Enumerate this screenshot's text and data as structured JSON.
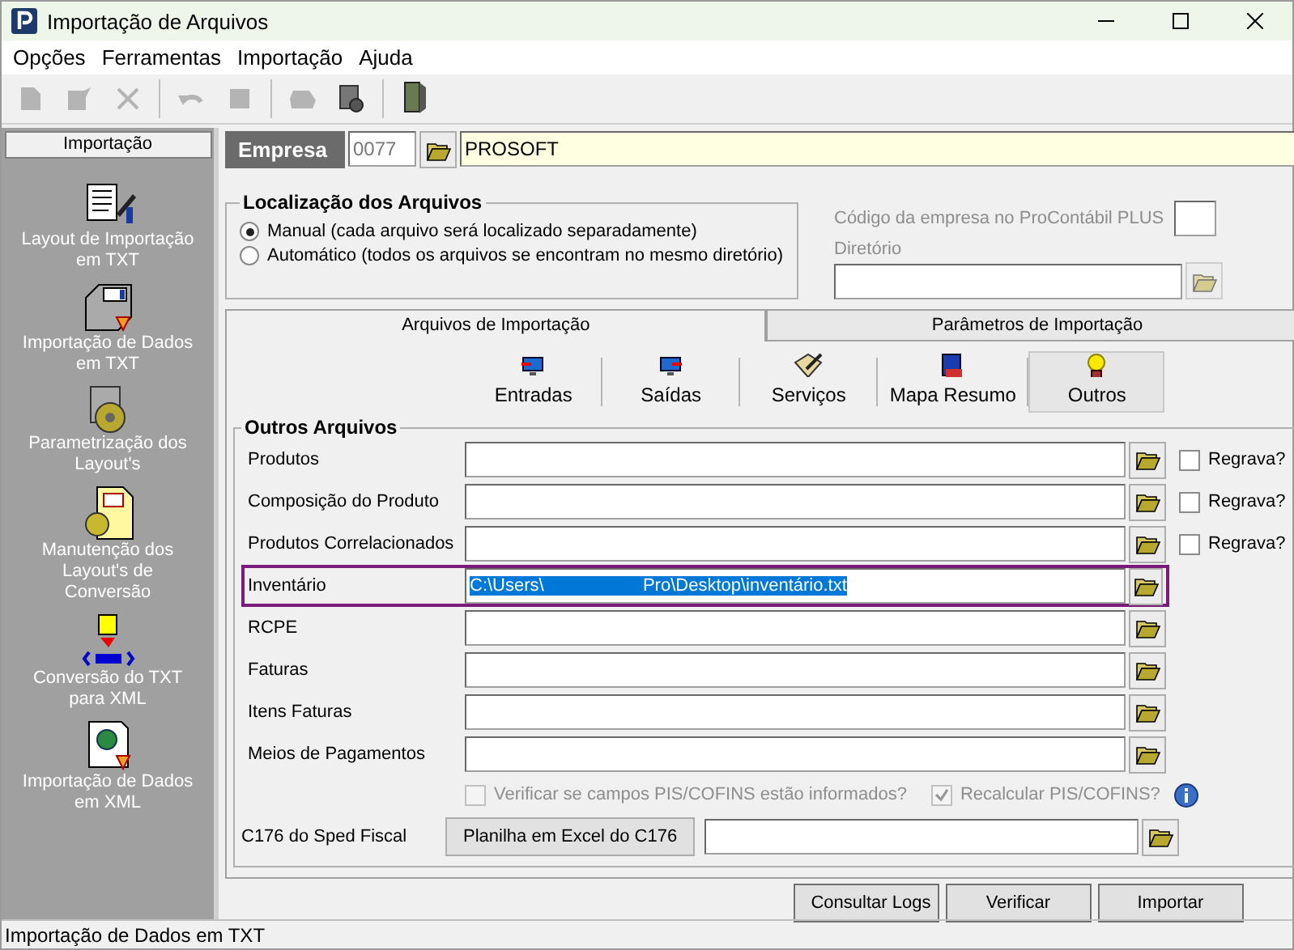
{
  "window": {
    "title": "Importação de Arquivos"
  },
  "menu": [
    "Opções",
    "Ferramentas",
    "Importação",
    "Ajuda"
  ],
  "toolbar": [
    {
      "kind": "new",
      "disabled": true
    },
    {
      "kind": "edit",
      "disabled": true
    },
    {
      "kind": "delete",
      "disabled": true
    },
    {
      "kind": "undo",
      "disabled": true
    },
    {
      "kind": "save",
      "disabled": true
    },
    {
      "kind": "print",
      "disabled": true
    },
    {
      "kind": "tools",
      "disabled": false
    },
    {
      "kind": "exit",
      "disabled": false
    }
  ],
  "sidebar": {
    "header": "Importação",
    "items": [
      {
        "label": "Layout de Importação em TXT",
        "kind": "layout"
      },
      {
        "label": "Importação de Dados em TXT",
        "kind": "import"
      },
      {
        "label": "Parametrização dos Layout's",
        "kind": "param"
      },
      {
        "label": "Manutenção dos Layout's de Conversão",
        "kind": "maint"
      },
      {
        "label": "Conversão do TXT para XML",
        "kind": "xml"
      },
      {
        "label": "Importação de Dados em XML",
        "kind": "webdoc"
      }
    ]
  },
  "empresa": {
    "label": "Empresa",
    "code": "0077",
    "name": "PROSOFT"
  },
  "location": {
    "title": "Localização dos Arquivos",
    "options": [
      {
        "label": "Manual (cada arquivo será localizado separadamente)",
        "selected": true
      },
      {
        "label": "Automático (todos os arquivos se encontram no mesmo diretório)",
        "selected": false
      }
    ]
  },
  "procontabil": {
    "label": "Código da empresa no ProContábil PLUS",
    "directory_label": "Diretório",
    "disabled": true
  },
  "tabs": [
    {
      "label": "Arquivos de Importação",
      "selected": true
    },
    {
      "label": "Parâmetros de Importação",
      "selected": false
    }
  ],
  "subtabs": [
    {
      "label": "Entradas",
      "kind": "monitor-in",
      "selected": false
    },
    {
      "label": "Saídas",
      "kind": "monitor-out",
      "selected": false
    },
    {
      "label": "Serviços",
      "kind": "pen",
      "selected": false
    },
    {
      "label": "Mapa Resumo",
      "kind": "book",
      "selected": false
    },
    {
      "label": "Outros",
      "kind": "bulb",
      "selected": true
    }
  ],
  "files": {
    "title": "Outros Arquivos",
    "rows": [
      {
        "label": "Produtos",
        "value": "",
        "highlighted": false,
        "regrava": {
          "label": "Regrava?",
          "checked": false
        }
      },
      {
        "label": "Composição do Produto",
        "value": "",
        "highlighted": false,
        "regrava": {
          "label": "Regrava?",
          "checked": false
        }
      },
      {
        "label": "Produtos Correlacionados",
        "value": "",
        "highlighted": false,
        "regrava": {
          "label": "Regrava?",
          "checked": false
        }
      },
      {
        "label": "Inventário",
        "value": "C:\\Users\\                    Pro\\Desktop\\inventário.txt",
        "highlighted": true
      },
      {
        "label": "RCPE",
        "value": "",
        "highlighted": false
      },
      {
        "label": "Faturas",
        "value": "",
        "highlighted": false
      },
      {
        "label": "Itens Faturas",
        "value": "",
        "highlighted": false
      },
      {
        "label": "Meios de Pagamentos",
        "value": "",
        "highlighted": false
      }
    ]
  },
  "options": [
    {
      "label": "Verificar se campos PIS/COFINS estão informados?",
      "checked": false,
      "disabled": true
    },
    {
      "label": "Recalcular PIS/COFINS?",
      "checked": true,
      "disabled": true
    }
  ],
  "c176": {
    "label": "C176 do Sped Fiscal",
    "button": "Planilha em Excel do C176"
  },
  "buttons": [
    "Consultar Logs",
    "Verificar",
    "Importar"
  ],
  "status_bar": "Importação de Dados em TXT"
}
